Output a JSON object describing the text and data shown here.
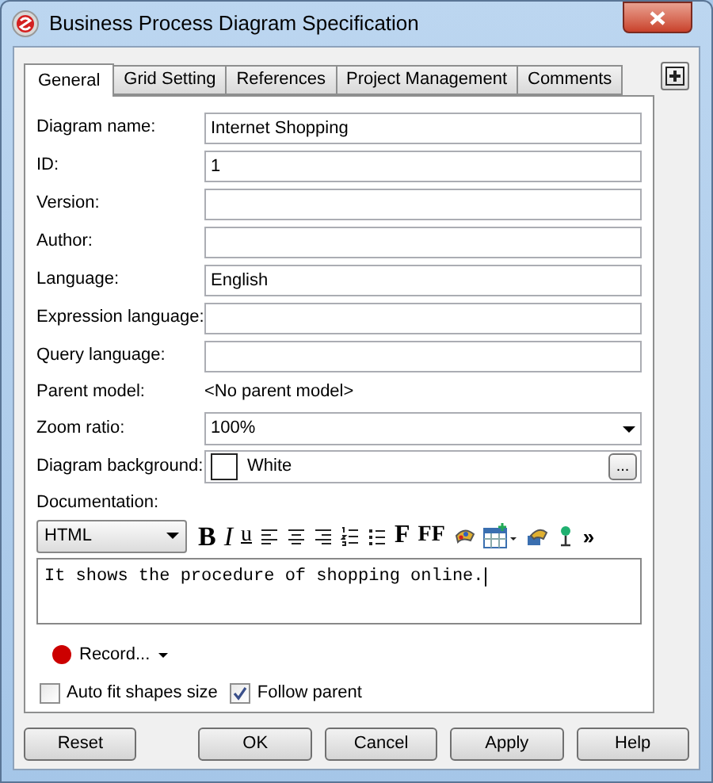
{
  "window": {
    "title": "Business Process Diagram Specification"
  },
  "tabs": [
    {
      "label": "General",
      "selected": true
    },
    {
      "label": "Grid Setting",
      "selected": false
    },
    {
      "label": "References",
      "selected": false
    },
    {
      "label": "Project Management",
      "selected": false
    },
    {
      "label": "Comments",
      "selected": false
    }
  ],
  "fields": [
    {
      "kind": "text",
      "label": "Diagram name:",
      "value": "Internet Shopping"
    },
    {
      "kind": "text",
      "label": "ID:",
      "value": "1"
    },
    {
      "kind": "text",
      "label": "Version:"
    },
    {
      "kind": "text",
      "label": "Author:"
    },
    {
      "kind": "text",
      "label": "Language:",
      "value": "English"
    },
    {
      "kind": "text",
      "label": "Expression language:"
    },
    {
      "kind": "text",
      "label": "Query language:"
    },
    {
      "kind": "static",
      "label": "Parent model:",
      "value": "<No parent model>"
    },
    {
      "kind": "combo",
      "label": "Zoom ratio:",
      "value": "100%"
    },
    {
      "kind": "color",
      "label": "Diagram background:",
      "value": "White",
      "color": "#ffffff",
      "button": "..."
    }
  ],
  "documentation": {
    "label": "Documentation:",
    "format": "HTML",
    "toolbar": [
      {
        "kind": "bold",
        "label": "B"
      },
      {
        "kind": "italic",
        "label": "I"
      },
      {
        "kind": "underline",
        "label": "u"
      },
      {
        "kind": "align-left"
      },
      {
        "kind": "align-center"
      },
      {
        "kind": "align-right"
      },
      {
        "kind": "numbered-list"
      },
      {
        "kind": "bullet-list"
      },
      {
        "kind": "font",
        "label": "F"
      },
      {
        "kind": "font-size",
        "label": "FF"
      },
      {
        "kind": "paint"
      },
      {
        "kind": "table"
      },
      {
        "kind": "link"
      },
      {
        "kind": "pin"
      },
      {
        "kind": "more",
        "label": "»"
      }
    ],
    "text": "It shows the procedure of shopping online."
  },
  "record": {
    "label": "Record..."
  },
  "checkboxes": [
    {
      "label": "Auto fit shapes size",
      "checked": false
    },
    {
      "label": "Follow parent",
      "checked": true
    }
  ],
  "buttons": [
    "Reset",
    "OK",
    "Cancel",
    "Apply",
    "Help"
  ]
}
